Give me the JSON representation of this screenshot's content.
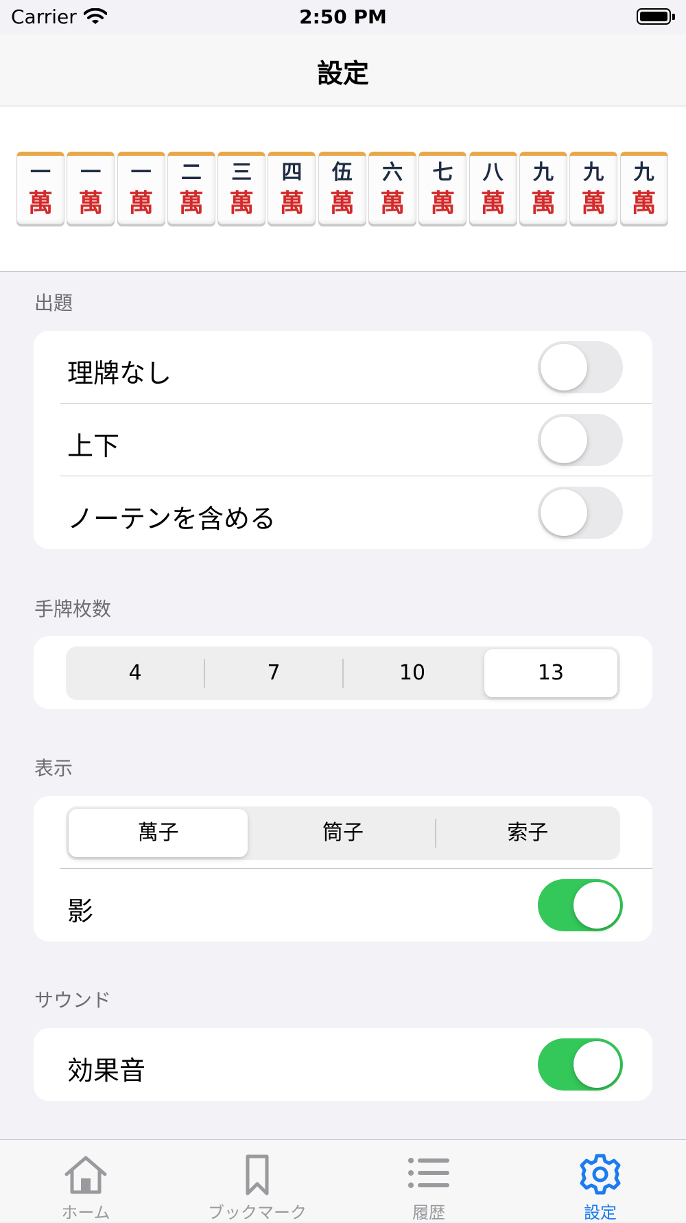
{
  "status_bar": {
    "carrier": "Carrier",
    "time": "2:50 PM"
  },
  "nav": {
    "title": "設定"
  },
  "tiles": [
    {
      "number": "一",
      "suit": "萬"
    },
    {
      "number": "一",
      "suit": "萬"
    },
    {
      "number": "一",
      "suit": "萬"
    },
    {
      "number": "二",
      "suit": "萬"
    },
    {
      "number": "三",
      "suit": "萬"
    },
    {
      "number": "四",
      "suit": "萬"
    },
    {
      "number": "伍",
      "suit": "萬"
    },
    {
      "number": "六",
      "suit": "萬"
    },
    {
      "number": "七",
      "suit": "萬"
    },
    {
      "number": "八",
      "suit": "萬"
    },
    {
      "number": "九",
      "suit": "萬"
    },
    {
      "number": "九",
      "suit": "萬"
    },
    {
      "number": "九",
      "suit": "萬"
    }
  ],
  "sections": {
    "question": {
      "header": "出題",
      "rows": [
        {
          "label": "理牌なし",
          "on": false
        },
        {
          "label": "上下",
          "on": false
        },
        {
          "label": "ノーテンを含める",
          "on": false
        }
      ]
    },
    "hand_count": {
      "header": "手牌枚数",
      "options": [
        "4",
        "7",
        "10",
        "13"
      ],
      "selected": "13"
    },
    "display": {
      "header": "表示",
      "options": [
        "萬子",
        "筒子",
        "索子"
      ],
      "selected": "萬子",
      "shadow_label": "影",
      "shadow_on": true
    },
    "sound": {
      "header": "サウンド",
      "effect_label": "効果音",
      "effect_on": true
    }
  },
  "tabs": [
    {
      "label": "ホーム",
      "icon": "house-icon",
      "active": false
    },
    {
      "label": "ブックマーク",
      "icon": "bookmark-icon",
      "active": false
    },
    {
      "label": "履歴",
      "icon": "list-icon",
      "active": false
    },
    {
      "label": "設定",
      "icon": "gear-icon",
      "active": true
    }
  ],
  "colors": {
    "accent": "#1a7cf0",
    "toggle_on": "#34c759",
    "toggle_off": "#e9e9eb",
    "tab_inactive": "#9a9a9e",
    "tile_number": "#1e2b44",
    "tile_suit": "#d32a2a"
  }
}
